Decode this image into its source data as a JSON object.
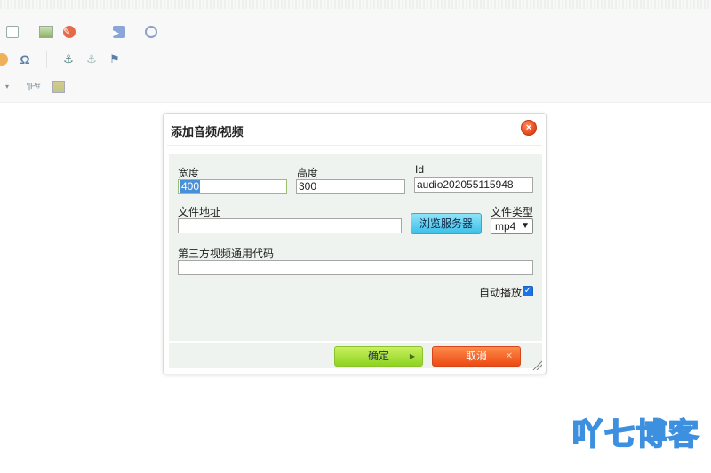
{
  "toolbar": {
    "row1_icons": [
      "search-doc-icon",
      "image-icon",
      "flash-icon",
      "media-icon",
      "map-icon"
    ],
    "row2_icons": [
      "emoji-icon",
      "omega-icon",
      "anchor-icon",
      "anchor-alt-icon",
      "flag-icon"
    ],
    "row3": {
      "page_break_label": "¶P#"
    }
  },
  "dialog": {
    "title": "添加音频/视频",
    "close_icon": "close-icon",
    "width_label": "宽度",
    "width_value": "400",
    "height_label": "高度",
    "height_value": "300",
    "id_label": "Id",
    "id_value": "audio202055115948",
    "url_label": "文件地址",
    "url_value": "",
    "browse_button": "浏览服务器",
    "filetype_label": "文件类型",
    "filetype_value": "mp4",
    "embed_label": "第三方视频通用代码",
    "embed_value": "",
    "autoplay_label": "自动播放",
    "autoplay_checked": true,
    "ok_button": "确定",
    "cancel_button": "取消"
  },
  "watermark": {
    "text": "吖七博客",
    "color": "#3d8fe0"
  }
}
